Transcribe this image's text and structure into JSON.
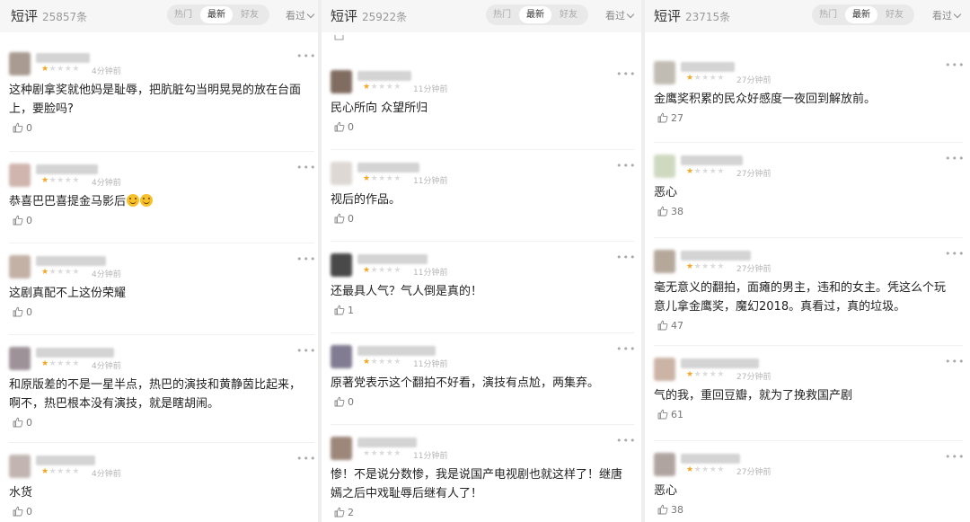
{
  "panels": [
    {
      "title": "短评",
      "count": "25857条",
      "tabs": [
        "热门",
        "最新",
        "好友"
      ],
      "active_tab": "最新",
      "seen_label": "看过",
      "reviews": [
        {
          "time": "4分钟前",
          "rating": 1,
          "content": "这种剧拿奖就他妈是耻辱，把肮脏勾当明晃晃的放在台面上，要脸吗?",
          "likes": "0"
        },
        {
          "time": "4分钟前",
          "rating": 1,
          "content": "恭喜巴巴喜提金马影后",
          "emoji_count": 2,
          "likes": "0"
        },
        {
          "time": "4分钟前",
          "rating": 1,
          "content": "这剧真配不上这份荣耀",
          "likes": "0"
        },
        {
          "time": "4分钟前",
          "rating": 1,
          "content": "和原版差的不是一星半点，热巴的演技和黄静茵比起来，啊不，热巴根本没有演技，就是瞎胡闹。",
          "likes": "0"
        },
        {
          "time": "4分钟前",
          "rating": 1,
          "content": "水货",
          "likes": "0"
        }
      ]
    },
    {
      "title": "短评",
      "count": "25922条",
      "tabs": [
        "热门",
        "最新",
        "好友"
      ],
      "active_tab": "最新",
      "seen_label": "看过",
      "reviews": [
        {
          "time": "11分钟前",
          "rating": 1,
          "content": "民心所向 众望所归",
          "likes": "0"
        },
        {
          "time": "11分钟前",
          "rating": 1,
          "content": "视后的作品。",
          "likes": "0"
        },
        {
          "time": "11分钟前",
          "rating": 1,
          "content": "还最具人气？气人倒是真的！",
          "likes": "1"
        },
        {
          "time": "11分钟前",
          "rating": 1,
          "content": "原著党表示这个翻拍不好看，演技有点尬，两集弃。",
          "likes": "0"
        },
        {
          "time": "11分钟前",
          "rating": 0,
          "content": "惨！不是说分数惨，我是说国产电视剧也就这样了！继唐嫣之后中戏耻辱后继有人了！",
          "likes": "2"
        }
      ]
    },
    {
      "title": "短评",
      "count": "23715条",
      "tabs": [
        "热门",
        "最新",
        "好友"
      ],
      "active_tab": "最新",
      "seen_label": "看过",
      "reviews": [
        {
          "time": "27分钟前",
          "rating": 1,
          "content": "金鹰奖积累的民众好感度一夜回到解放前。",
          "likes": "27"
        },
        {
          "time": "27分钟前",
          "rating": 1,
          "content": "恶心",
          "likes": "38"
        },
        {
          "time": "27分钟前",
          "rating": 1,
          "content": "毫无意义的翻拍，面瘫的男主，违和的女主。凭这么个玩意儿拿金鹰奖，魔幻2018。真看过，真的垃圾。",
          "likes": "47"
        },
        {
          "time": "27分钟前",
          "rating": 1,
          "content": "气的我，重回豆瓣，就为了挽救国产剧",
          "likes": "61"
        },
        {
          "time": "27分钟前",
          "rating": 1,
          "content": "恶心",
          "likes": "38"
        }
      ]
    }
  ],
  "avatar_colors": [
    [
      "#9a8a7e",
      "#c7a9a0",
      "#b9a497",
      "#8e8088",
      "#b8a9a4"
    ],
    [
      "#6b5346",
      "#d8d2cc",
      "#2a2a2a",
      "#6c6680",
      "#8c7364"
    ],
    [
      "#b7b1a6",
      "#c7d3b6",
      "#a99a8a",
      "#c2a797",
      "#a39590"
    ]
  ]
}
